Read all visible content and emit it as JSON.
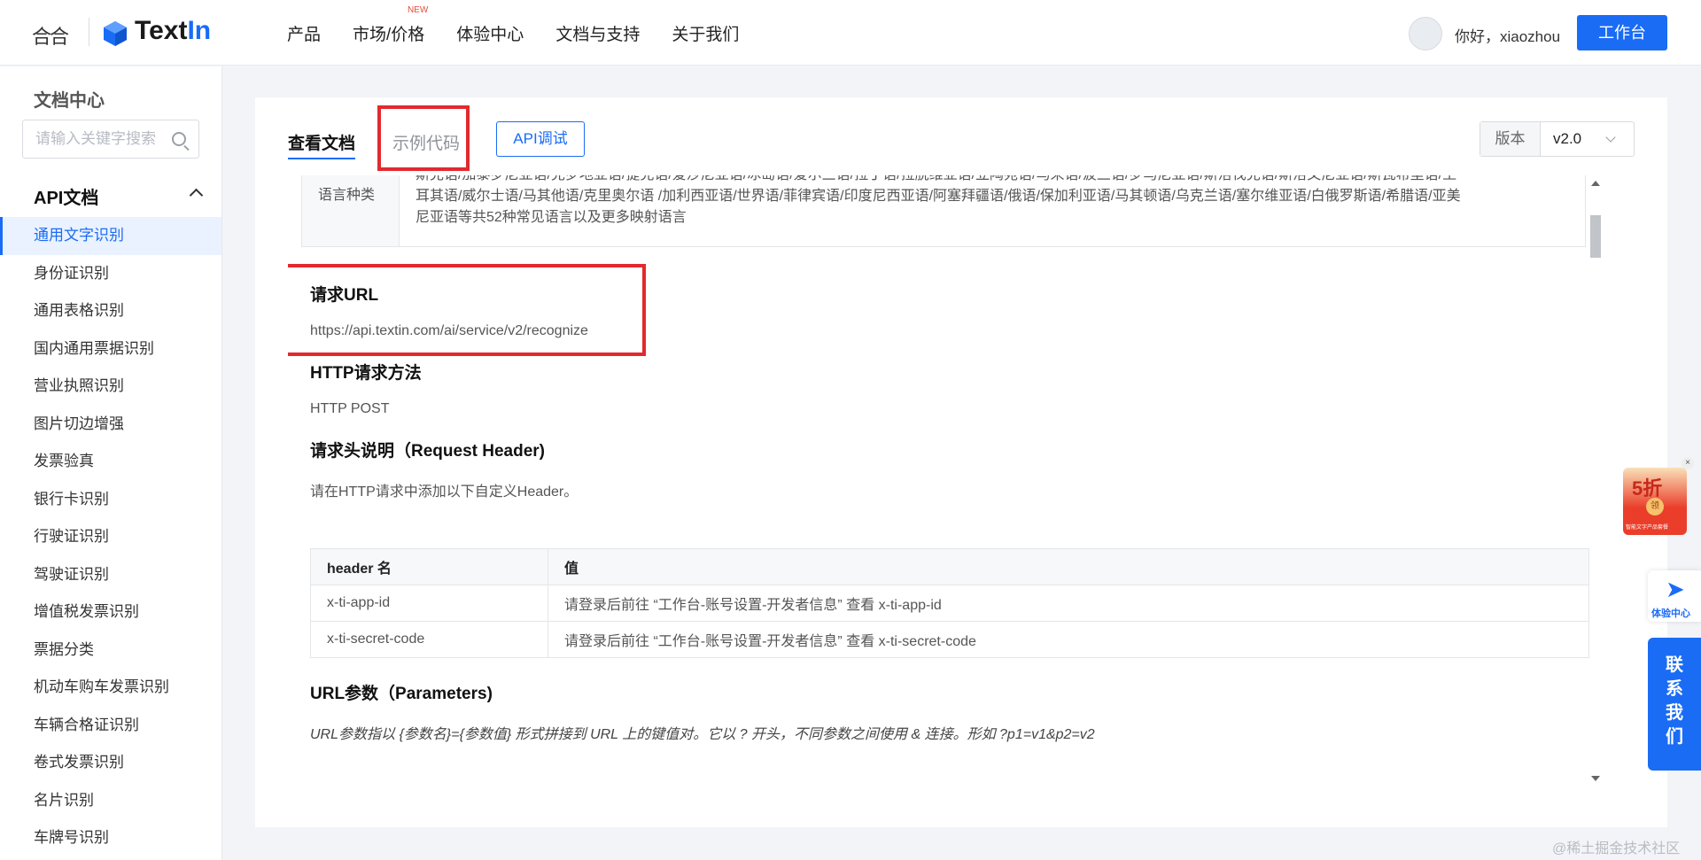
{
  "header": {
    "logo_left": "合合",
    "brand": "TextIn",
    "brand_prefix": "Text",
    "brand_suffix": "In",
    "nav": [
      {
        "label": "产品",
        "badge": ""
      },
      {
        "label": "市场/价格",
        "badge": "NEW"
      },
      {
        "label": "体验中心",
        "badge": ""
      },
      {
        "label": "文档与支持",
        "badge": ""
      },
      {
        "label": "关于我们",
        "badge": ""
      }
    ],
    "greeting": "你好，xiaozhou",
    "workbench": "工作台"
  },
  "sidebar": {
    "title": "文档中心",
    "search_placeholder": "请输入关键字搜索",
    "section": "API文档",
    "items": [
      "通用文字识别",
      "身份证识别",
      "通用表格识别",
      "国内通用票据识别",
      "营业执照识别",
      "图片切边增强",
      "发票验真",
      "银行卡识别",
      "行驶证识别",
      "驾驶证识别",
      "增值税发票识别",
      "票据分类",
      "机动车购车发票识别",
      "车辆合格证识别",
      "卷式发票识别",
      "名片识别",
      "车牌号识别"
    ],
    "active_index": 0
  },
  "tabs": {
    "doc": "查看文档",
    "code": "示例代码",
    "debug": "API调试"
  },
  "version": {
    "label": "版本",
    "value": "v2.0"
  },
  "doc": {
    "lang_head": "语言种类",
    "lang_lines": [
      "斯克语/加泰罗尼亚语/克罗地亚语/捷克语/爱沙尼亚语/冰岛语/爱尔兰语/拉丁语/拉脱维亚语/立陶宛语/马来语/波兰语/罗马尼亚语/斯洛伐克语/斯洛文尼亚语/斯瓦希里语/土",
      "耳其语/威尔士语/马其他语/克里奥尔语 /加利西亚语/世界语/菲律宾语/印度尼西亚语/阿塞拜疆语/俄语/保加利亚语/马其顿语/乌克兰语/塞尔维亚语/白俄罗斯语/希腊语/亚美",
      "尼亚语等共52种常见语言以及更多映射语言"
    ],
    "url_title": "请求URL",
    "url_value": "https://api.textin.com/ai/service/v2/recognize",
    "method_title": "HTTP请求方法",
    "method_value": "HTTP POST",
    "header_title": "请求头说明（Request Header)",
    "header_desc": "请在HTTP请求中添加以下自定义Header。",
    "header_table": {
      "columns": [
        "header 名",
        "值"
      ],
      "rows": [
        [
          "x-ti-app-id",
          "请登录后前往 “工作台-账号设置-开发者信息” 查看 x-ti-app-id"
        ],
        [
          "x-ti-secret-code",
          "请登录后前往 “工作台-账号设置-开发者信息” 查看 x-ti-secret-code"
        ]
      ]
    },
    "params_title": "URL参数（Parameters)",
    "params_desc": "URL参数指以 {参数名}={参数值} 形式拼接到 URL 上的键值对。它以 ? 开头，不同参数之间使用 & 连接。形如 ?p1=v1&p2=v2"
  },
  "float": {
    "promo_close": "×",
    "promo_big": "5折",
    "promo_coin": "领",
    "promo_small": "智能文字产品套餐",
    "exp_label": "体验中心",
    "contact_chars": [
      "联",
      "系",
      "我",
      "们"
    ]
  },
  "watermark": "@稀土掘金技术社区",
  "colors": {
    "accent": "#1a6cf5",
    "highlight": "#e12a2f"
  }
}
